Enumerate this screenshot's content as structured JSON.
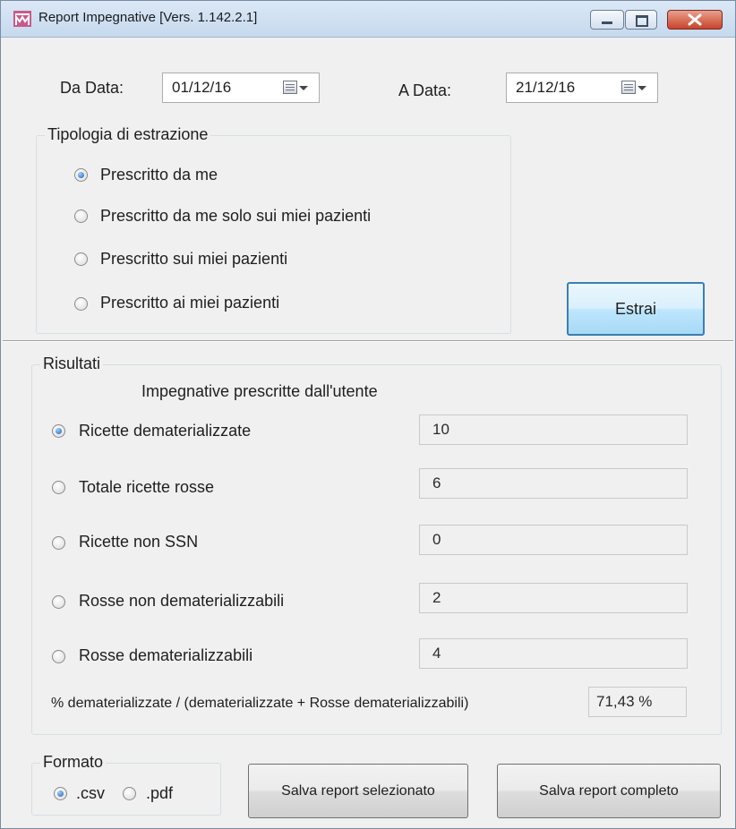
{
  "window": {
    "title": "Report Impegnative [Vers. 1.142.2.1]"
  },
  "dates": {
    "from_label": "Da Data:",
    "from_value": "01/12/16",
    "to_label": "A Data:",
    "to_value": "21/12/16"
  },
  "extraction": {
    "legend": "Tipologia di estrazione",
    "options": [
      {
        "label": "Prescritto da me",
        "selected": true
      },
      {
        "label": "Prescritto da me solo sui miei pazienti",
        "selected": false
      },
      {
        "label": "Prescritto sui miei pazienti",
        "selected": false
      },
      {
        "label": "Prescritto ai miei pazienti",
        "selected": false
      }
    ],
    "extract_button": "Estrai"
  },
  "results": {
    "legend": "Risultati",
    "subtitle": "Impegnative prescritte dall'utente",
    "rows": [
      {
        "label": "Ricette dematerializzate",
        "value": "10",
        "selected": true
      },
      {
        "label": "Totale ricette rosse",
        "value": "6",
        "selected": false
      },
      {
        "label": "Ricette non SSN",
        "value": "0",
        "selected": false
      },
      {
        "label": "Rosse non dematerializzabili",
        "value": "2",
        "selected": false
      },
      {
        "label": "Rosse dematerializzabili",
        "value": "4",
        "selected": false
      }
    ],
    "percent_label": "% dematerializzate / (dematerializzate + Rosse dematerializzabili)",
    "percent_value": "71,43 %"
  },
  "format": {
    "legend": "Formato",
    "options": [
      {
        "label": ".csv",
        "selected": true
      },
      {
        "label": ".pdf",
        "selected": false
      }
    ]
  },
  "actions": {
    "save_selected": "Salva report selezionato",
    "save_complete": "Salva report completo"
  }
}
